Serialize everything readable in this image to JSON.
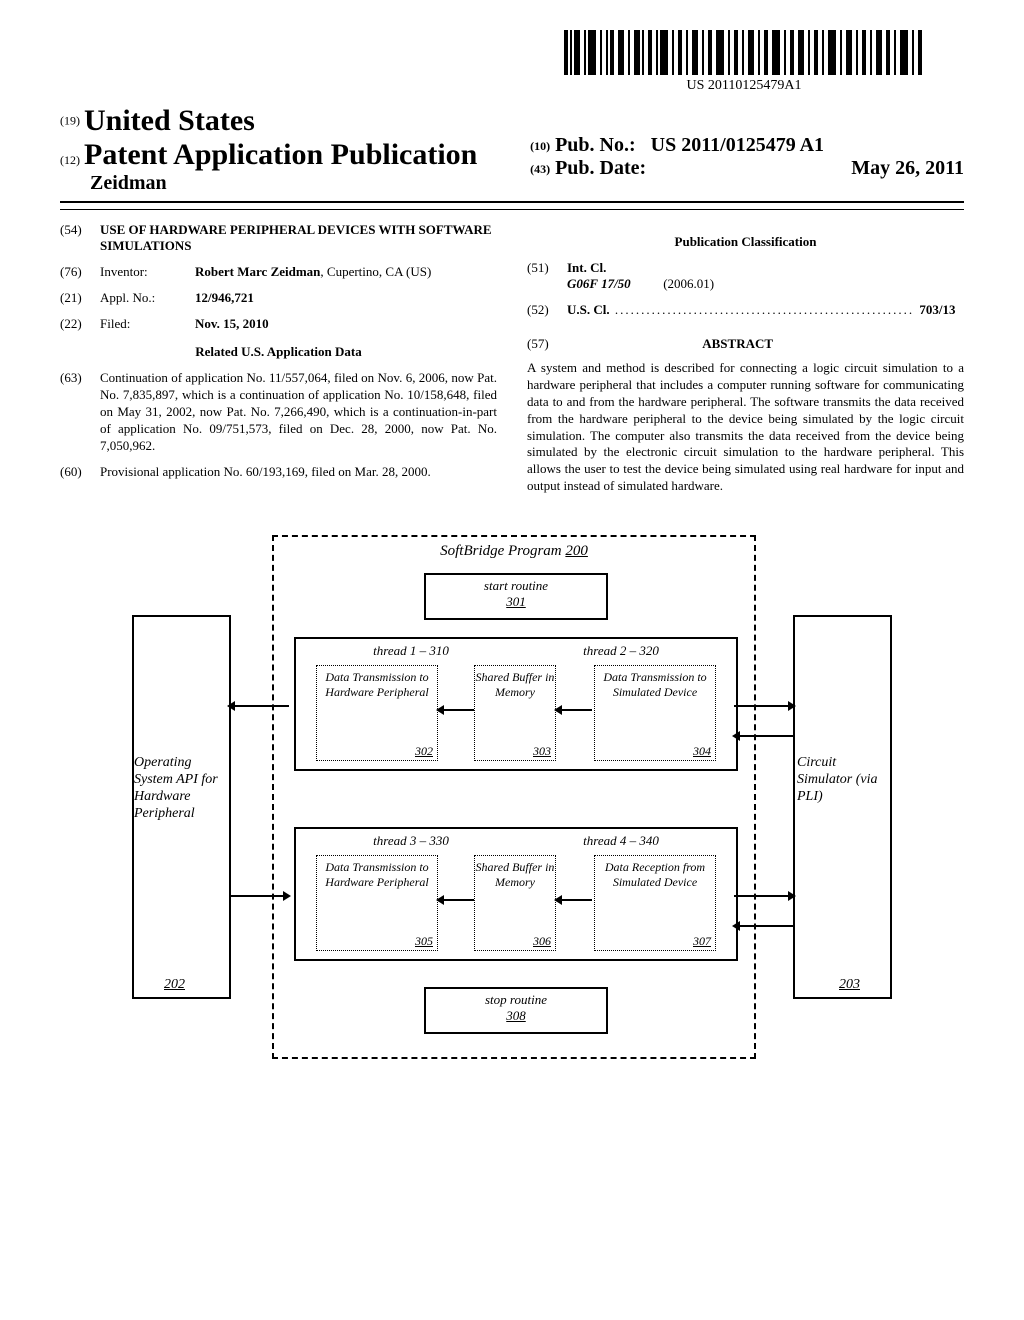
{
  "barcode_pub_id": "US 20110125479A1",
  "header": {
    "code_19": "(19)",
    "country": "United States",
    "code_12": "(12)",
    "doc_type": "Patent Application Publication",
    "inventor_surname": "Zeidman",
    "code_10": "(10)",
    "pub_no_label": "Pub. No.:",
    "pub_no": "US 2011/0125479 A1",
    "code_43": "(43)",
    "pub_date_label": "Pub. Date:",
    "pub_date": "May 26, 2011"
  },
  "biblio": {
    "c54": "(54)",
    "title": "USE OF HARDWARE PERIPHERAL DEVICES WITH SOFTWARE SIMULATIONS",
    "c76": "(76)",
    "inventor_label": "Inventor:",
    "inventor_name": "Robert Marc Zeidman",
    "inventor_loc": ", Cupertino, CA (US)",
    "c21": "(21)",
    "appl_label": "Appl. No.:",
    "appl_no": "12/946,721",
    "c22": "(22)",
    "filed_label": "Filed:",
    "filed_date": "Nov. 15, 2010",
    "related_heading": "Related U.S. Application Data",
    "c63": "(63)",
    "continuation_text": "Continuation of application No. 11/557,064, filed on Nov. 6, 2006, now Pat. No. 7,835,897, which is a continuation of application No. 10/158,648, filed on May 31, 2002, now Pat. No. 7,266,490, which is a continuation-in-part of application No. 09/751,573, filed on Dec. 28, 2000, now Pat. No. 7,050,962.",
    "c60": "(60)",
    "provisional_text": "Provisional application No. 60/193,169, filed on Mar. 28, 2000."
  },
  "classification": {
    "heading": "Publication Classification",
    "c51": "(51)",
    "intcl_label": "Int. Cl.",
    "intcl_code": "G06F 17/50",
    "intcl_date": "(2006.01)",
    "c52": "(52)",
    "uscl_label": "U.S. Cl.",
    "uscl_dots": " ......................................................... ",
    "uscl_value": "703/13"
  },
  "abstract": {
    "c57": "(57)",
    "heading": "ABSTRACT",
    "text": "A system and method is described for connecting a logic circuit simulation to a hardware peripheral that includes a computer running software for communicating data to and from the hardware peripheral. The software transmits the data received from the hardware peripheral to the device being simulated by the logic circuit simulation. The computer also transmits the data received from the device being simulated by the electronic circuit simulation to the hardware peripheral. This allows the user to test the device being simulated using real hardware for input and output instead of simulated hardware."
  },
  "diagram": {
    "program_title": "SoftBridge Program",
    "program_ref": "200",
    "start_routine": "start routine",
    "start_ref": "301",
    "stop_routine": "stop routine",
    "stop_ref": "308",
    "os_label": "Operating System API for Hardware Peripheral",
    "os_ref": "202",
    "cs_label": "Circuit Simulator (via PLI)",
    "cs_ref": "203",
    "thread1": "thread 1 – 310",
    "thread2": "thread 2 – 320",
    "thread3": "thread 3 – 330",
    "thread4": "thread 4 – 340",
    "box302": "Data Transmission to Hardware Peripheral",
    "ref302": "302",
    "box303": "Shared Buffer in Memory",
    "ref303": "303",
    "box304": "Data Transmission to Simulated Device",
    "ref304": "304",
    "box305": "Data Transmission to Hardware Peripheral",
    "ref305": "305",
    "box306": "Shared Buffer in Memory",
    "ref306": "306",
    "box307": "Data Reception from Simulated Device",
    "ref307": "307"
  }
}
